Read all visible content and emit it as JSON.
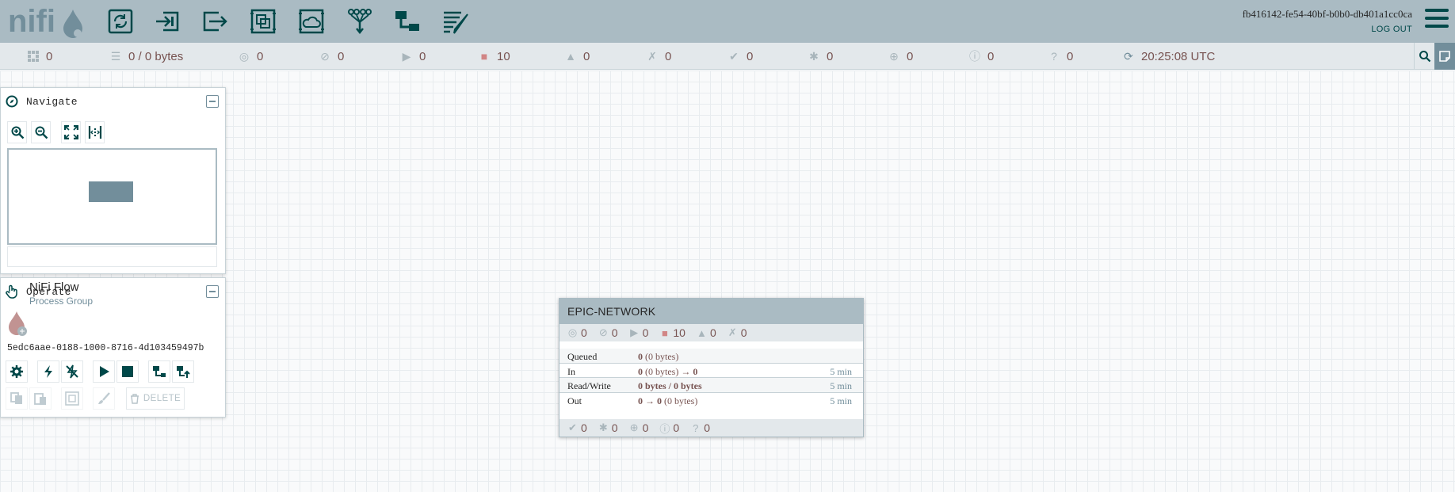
{
  "header": {
    "logo_text": "nifi",
    "user_id": "fb416142-fe54-40bf-b0b0-db401a1cc0ca",
    "logout_label": "LOG OUT",
    "toolbar": [
      "processor-icon",
      "input-port-icon",
      "output-port-icon",
      "process-group-icon",
      "remote-process-group-icon",
      "funnel-icon",
      "template-icon",
      "label-icon"
    ]
  },
  "status_bar": {
    "active_threads": "0",
    "queued": "0 / 0 bytes",
    "transmitting": "0",
    "not_transmitting": "0",
    "running": "0",
    "stopped": "10",
    "invalid": "0",
    "disabled": "0",
    "up_to_date": "0",
    "locally_modified": "0",
    "stale": "0",
    "sync_failure": "0",
    "errors": "0",
    "last_refreshed": "20:25:08 UTC"
  },
  "navigate": {
    "title": "Navigate"
  },
  "operate": {
    "title": "Operate",
    "component_name": "NiFi Flow",
    "component_type": "Process Group",
    "component_id": "5edc6aae-0188-1000-8716-4d103459497b",
    "delete_label": "DELETE"
  },
  "process_group": {
    "name": "EPIC-NETWORK",
    "top_stats": {
      "transmitting": "0",
      "not_transmitting": "0",
      "running": "0",
      "stopped": "10",
      "invalid": "0",
      "disabled": "0"
    },
    "rows": [
      {
        "label": "Queued",
        "value_bold": "0",
        "value_rest": " (0 bytes)",
        "time": ""
      },
      {
        "label": "In",
        "value_bold": "0",
        "value_rest": " (0 bytes) → ",
        "value_tail": "0",
        "time": "5 min"
      },
      {
        "label": "Read/Write",
        "value_bold": "0 bytes / 0 bytes",
        "value_rest": "",
        "time": "5 min"
      },
      {
        "label": "Out",
        "value_bold": "0 → 0",
        "value_rest": " (0 bytes)",
        "time": "5 min"
      }
    ],
    "bottom_stats": {
      "up_to_date": "0",
      "locally_modified": "0",
      "stale": "0",
      "sync_failure": "0",
      "unknown": "0"
    }
  },
  "colors": {
    "header_bg": "#aabbc3",
    "brand_dark": "#004849",
    "stat_text": "#775351",
    "stopped_red": "#d18686",
    "view_rect": "#728e9b"
  }
}
